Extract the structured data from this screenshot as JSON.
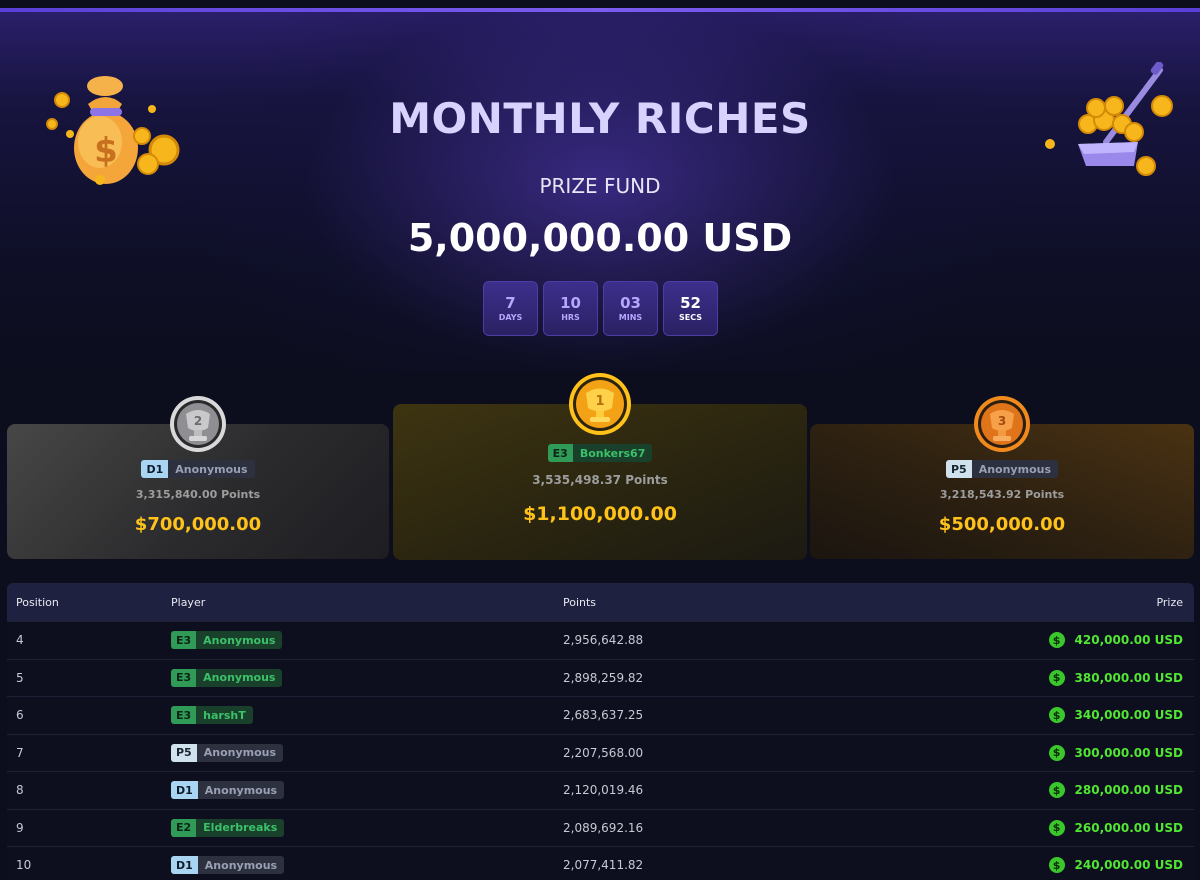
{
  "hero": {
    "title": "MONTHLY RICHES",
    "subtitle": "PRIZE FUND",
    "amount": "5,000,000.00 USD",
    "countdown": [
      {
        "value": "7",
        "label": "DAYS"
      },
      {
        "value": "10",
        "label": "HRS"
      },
      {
        "value": "03",
        "label": "MINS"
      },
      {
        "value": "52",
        "label": "SECS"
      }
    ]
  },
  "podium": {
    "first": {
      "rank": "1",
      "level": "E3",
      "name": "Bonkers67",
      "points": "3,535,498.37 Points",
      "prize": "$1,100,000.00"
    },
    "second": {
      "rank": "2",
      "level": "D1",
      "name": "Anonymous",
      "points": "3,315,840.00 Points",
      "prize": "$700,000.00"
    },
    "third": {
      "rank": "3",
      "level": "P5",
      "name": "Anonymous",
      "points": "3,218,543.92 Points",
      "prize": "$500,000.00"
    }
  },
  "table": {
    "headers": {
      "position": "Position",
      "player": "Player",
      "points": "Points",
      "prize": "Prize"
    },
    "currency_icon": "$",
    "rows": [
      {
        "position": "4",
        "level": "E3",
        "name": "Anonymous",
        "points": "2,956,642.88",
        "prize": "420,000.00 USD"
      },
      {
        "position": "5",
        "level": "E3",
        "name": "Anonymous",
        "points": "2,898,259.82",
        "prize": "380,000.00 USD"
      },
      {
        "position": "6",
        "level": "E3",
        "name": "harshT",
        "points": "2,683,637.25",
        "prize": "340,000.00 USD"
      },
      {
        "position": "7",
        "level": "P5",
        "name": "Anonymous",
        "points": "2,207,568.00",
        "prize": "300,000.00 USD"
      },
      {
        "position": "8",
        "level": "D1",
        "name": "Anonymous",
        "points": "2,120,019.46",
        "prize": "280,000.00 USD"
      },
      {
        "position": "9",
        "level": "E2",
        "name": "Elderbreaks",
        "points": "2,089,692.16",
        "prize": "260,000.00 USD"
      },
      {
        "position": "10",
        "level": "D1",
        "name": "Anonymous",
        "points": "2,077,411.82",
        "prize": "240,000.00 USD"
      }
    ]
  },
  "colors": {
    "accent": "#5a3fd8",
    "gold": "#ffc21a",
    "prize_green": "#50e632"
  },
  "icons": {
    "left_decoration": "money-bag-icon",
    "right_decoration": "coin-shovel-icon",
    "gold_medal": "gold-trophy-medal-icon",
    "silver_medal": "silver-trophy-medal-icon",
    "bronze_medal": "bronze-trophy-medal-icon"
  }
}
